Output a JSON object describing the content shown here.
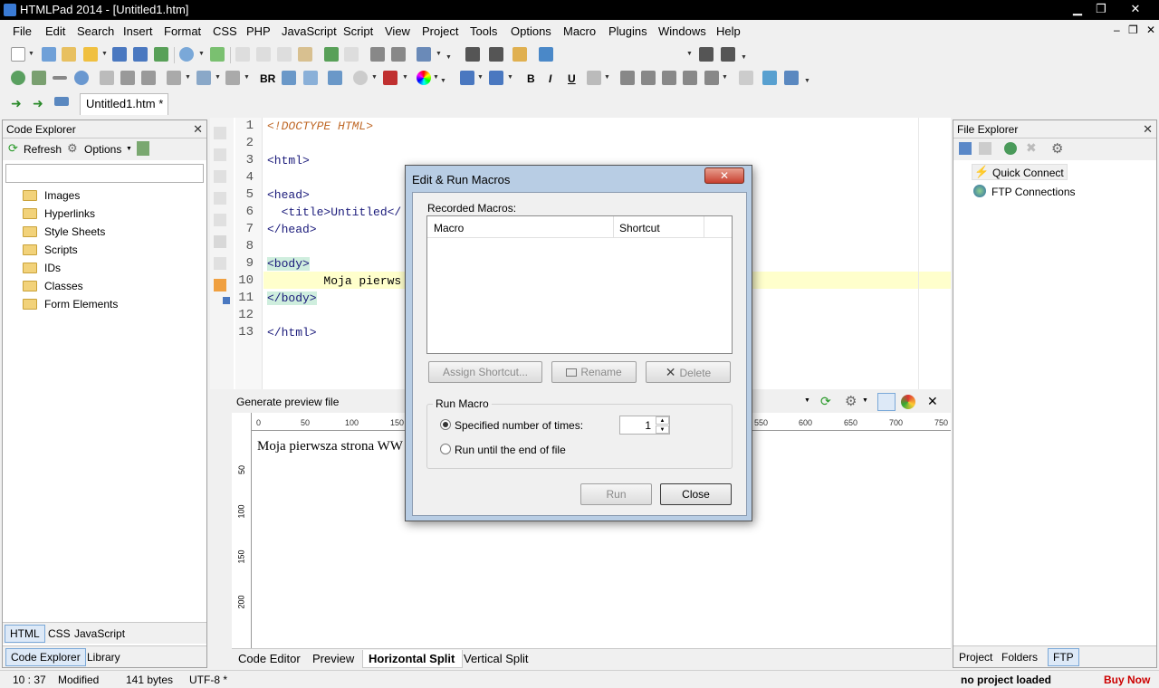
{
  "window": {
    "title": "HTMLPad 2014 - [Untitled1.htm]",
    "controls": {
      "minimize": "▁",
      "restore": "❐",
      "close": "✕"
    }
  },
  "menu": [
    "File",
    "Edit",
    "Search",
    "Insert",
    "Format",
    "CSS",
    "PHP",
    "JavaScript",
    "Script",
    "View",
    "Project",
    "Tools",
    "Options",
    "Macro",
    "Plugins",
    "Windows",
    "Help"
  ],
  "mdi_controls": {
    "minimize": "–",
    "restore": "❐",
    "close": "✕"
  },
  "format_toolbar": {
    "br": "BR",
    "bold": "B",
    "italic": "I",
    "underline": "U"
  },
  "document_tab": "Untitled1.htm *",
  "code_explorer": {
    "title": "Code Explorer",
    "refresh": "Refresh",
    "options": "Options",
    "search_placeholder": "",
    "items": [
      "Images",
      "Hyperlinks",
      "Style Sheets",
      "Scripts",
      "IDs",
      "Classes",
      "Form Elements"
    ],
    "lang_tabs": [
      "HTML",
      "CSS",
      "JavaScript"
    ],
    "bottom_tabs": [
      "Code Explorer",
      "Library"
    ]
  },
  "editor": {
    "line_numbers": [
      "1",
      "2",
      "3",
      "4",
      "5",
      "6",
      "7",
      "8",
      "9",
      "10",
      "11",
      "12",
      "13"
    ],
    "lines": [
      "<!DOCTYPE HTML>",
      "",
      "<html>",
      "",
      "<head>",
      "  <title>Untitled</",
      "</head>",
      "",
      "<body>",
      "        Moja pierws",
      "</body>",
      "",
      "</html>"
    ]
  },
  "preview": {
    "title": "Generate preview file",
    "ruler_top": [
      "0",
      "50",
      "100",
      "150",
      "550",
      "600",
      "650",
      "700",
      "750"
    ],
    "ruler_left": [
      "50",
      "100",
      "150",
      "200"
    ],
    "content": "Moja pierwsza strona WW"
  },
  "editor_view_tabs": [
    "Code Editor",
    "Preview",
    "Horizontal Split",
    "Vertical Split"
  ],
  "file_explorer": {
    "title": "File Explorer",
    "items": [
      "Quick Connect",
      "FTP Connections"
    ],
    "bottom_tabs": [
      "Project",
      "Folders",
      "FTP"
    ]
  },
  "status": {
    "position": "10 : 37",
    "state": "Modified",
    "size": "141 bytes",
    "encoding": "UTF-8 *",
    "project": "no project loaded",
    "buy": "Buy Now"
  },
  "dialog": {
    "title": "Edit & Run Macros",
    "recorded_label": "Recorded Macros:",
    "columns": [
      "Macro",
      "Shortcut"
    ],
    "assign_button": "Assign Shortcut...",
    "rename_button": "Rename",
    "delete_button": "Delete",
    "run_group": "Run Macro",
    "option_times": "Specified number of times:",
    "times_value": "1",
    "option_eof": "Run until the end of file",
    "run_button": "Run",
    "close_button": "Close"
  },
  "colors": {
    "accent": "#3399ff",
    "buy_now": "#cc0000",
    "highlight_line": "#ffffcc"
  }
}
